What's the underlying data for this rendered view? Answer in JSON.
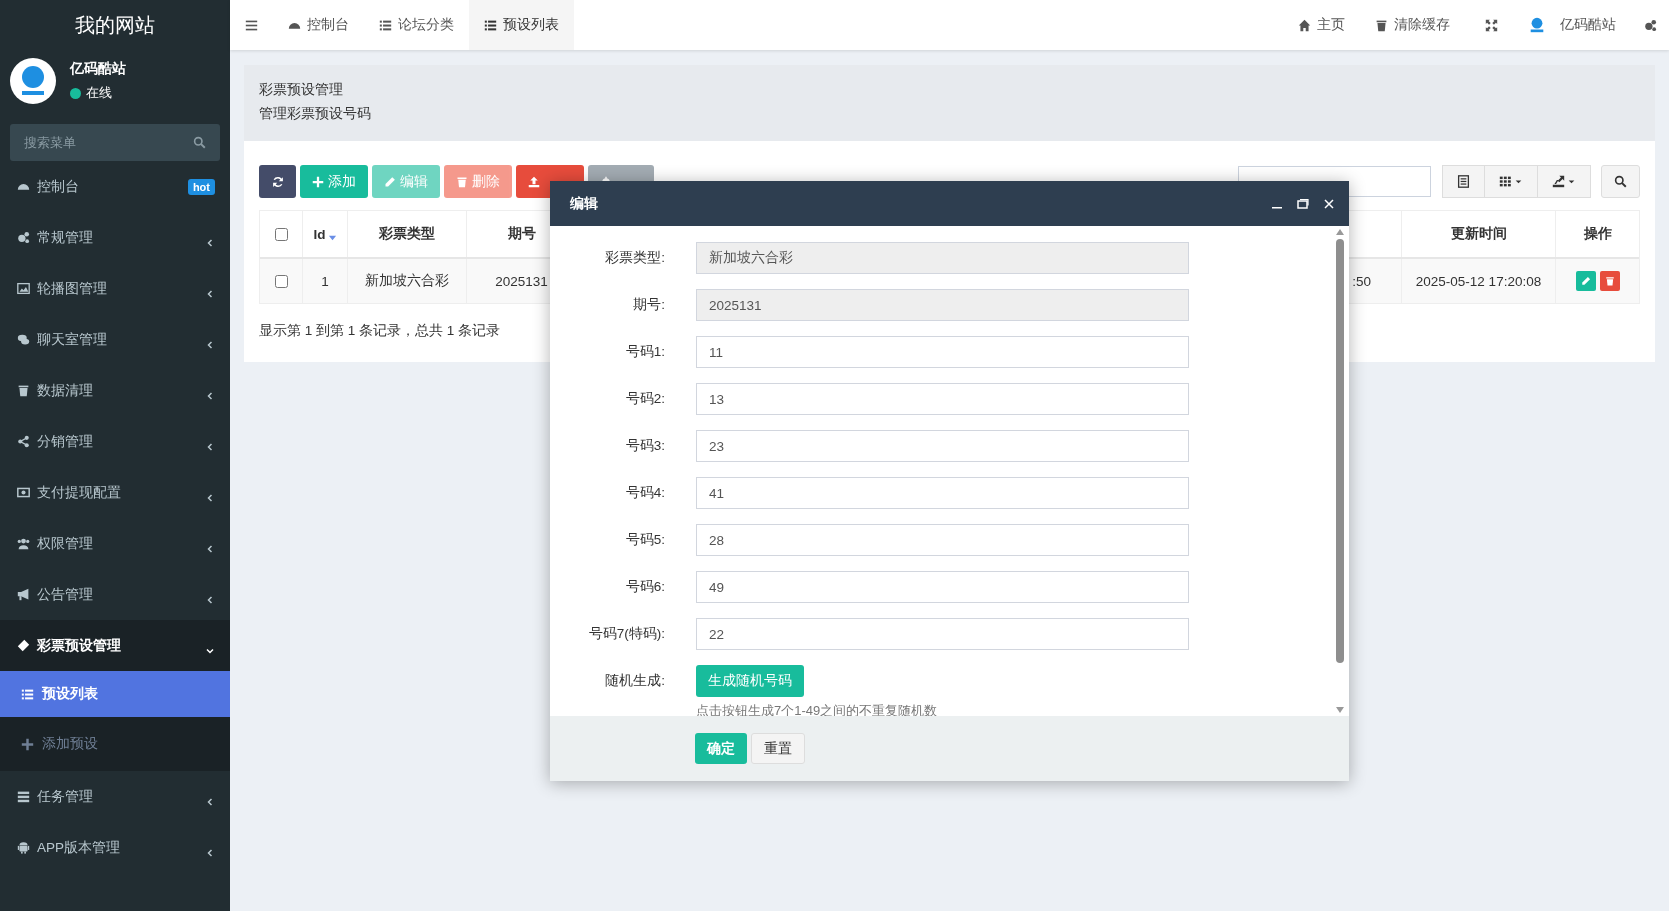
{
  "sidebar": {
    "site_title": "我的网站",
    "user": {
      "name": "亿码酷站",
      "status": "在线",
      "online": true
    },
    "search": {
      "placeholder": "搜索菜单"
    },
    "menu": [
      {
        "label": "控制台",
        "badge": "hot",
        "selected": false
      },
      {
        "label": "常规管理",
        "expanded": false,
        "selected": false
      },
      {
        "label": "轮播图管理",
        "expanded": false,
        "selected": false
      },
      {
        "label": "聊天室管理",
        "expanded": false,
        "selected": false
      },
      {
        "label": "数据清理",
        "expanded": false,
        "selected": false
      },
      {
        "label": "分销管理",
        "expanded": false,
        "selected": false
      },
      {
        "label": "支付提现配置",
        "expanded": false,
        "selected": false
      },
      {
        "label": "权限管理",
        "expanded": false,
        "selected": false
      },
      {
        "label": "公告管理",
        "expanded": false,
        "selected": false
      },
      {
        "label": "彩票预设管理",
        "expanded": true,
        "selected": false,
        "children": [
          {
            "label": "预设列表",
            "selected": true
          },
          {
            "label": "添加预设",
            "selected": false
          }
        ]
      },
      {
        "label": "任务管理",
        "expanded": false,
        "selected": false
      },
      {
        "label": "APP版本管理",
        "expanded": false,
        "selected": false
      }
    ]
  },
  "topbar": {
    "tabs": [
      {
        "label": "控制台",
        "selected": false
      },
      {
        "label": "论坛分类",
        "selected": false
      },
      {
        "label": "预设列表",
        "selected": true
      }
    ],
    "links": [
      {
        "label": "主页"
      },
      {
        "label": "清除缓存"
      }
    ],
    "user_name": "亿码酷站"
  },
  "page_header": {
    "title": "彩票预设管理",
    "subtitle": "管理彩票预设号码"
  },
  "toolbar": {
    "buttons": [
      {
        "kind": "refresh",
        "disabled": false
      },
      {
        "kind": "add",
        "label": "添加",
        "disabled": false
      },
      {
        "kind": "edit",
        "label": "编辑",
        "disabled": true
      },
      {
        "kind": "delete",
        "label": "删除",
        "disabled": true
      },
      {
        "kind": "import",
        "disabled": false
      },
      {
        "kind": "more",
        "disabled": true
      }
    ]
  },
  "table": {
    "select_all_checked": false,
    "columns": [
      {
        "label": "Id",
        "sorted": true
      },
      {
        "label": "彩票类型",
        "sorted": false
      },
      {
        "label": "期号",
        "sorted": false
      },
      {
        "label": "更新时间",
        "sorted": false
      },
      {
        "label": "操作",
        "sorted": false
      }
    ],
    "rows": [
      {
        "checked": false,
        "id": "1",
        "type": "新加坡六合彩",
        "period": "2025131",
        "partial_time": ":50",
        "updated": "2025-05-12 17:20:08"
      }
    ]
  },
  "pagination_text": "显示第 1 到第 1 条记录，总共 1 条记录",
  "dialog": {
    "title": "编辑",
    "fields": [
      {
        "label": "彩票类型:",
        "value": "新加坡六合彩",
        "readonly": true
      },
      {
        "label": "期号:",
        "value": "2025131",
        "readonly": true
      },
      {
        "label": "号码1:",
        "value": "11",
        "readonly": false
      },
      {
        "label": "号码2:",
        "value": "13",
        "readonly": false
      },
      {
        "label": "号码3:",
        "value": "23",
        "readonly": false
      },
      {
        "label": "号码4:",
        "value": "41",
        "readonly": false
      },
      {
        "label": "号码5:",
        "value": "28",
        "readonly": false
      },
      {
        "label": "号码6:",
        "value": "49",
        "readonly": false
      },
      {
        "label": "号码7(特码):",
        "value": "22",
        "readonly": false
      }
    ],
    "random": {
      "label": "随机生成:",
      "button": "生成随机号码",
      "hint": "点击按钮生成7个1-49之间的不重复随机数"
    },
    "buttons": [
      {
        "label": "确定",
        "kind": "primary"
      },
      {
        "label": "重置",
        "kind": "default"
      }
    ]
  }
}
